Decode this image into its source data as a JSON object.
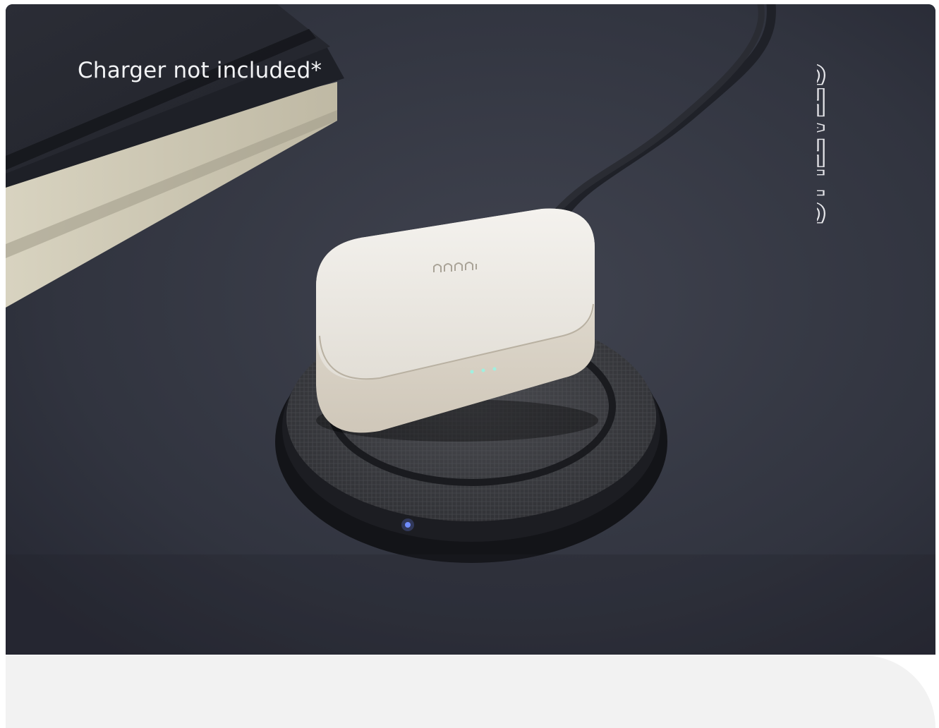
{
  "caption": "Charger not included*",
  "brand_text": "STATUS",
  "colors": {
    "desk": "#30333f",
    "case": "#ece8e0",
    "charger_fabric": "#3b3c40",
    "indicator_light": "#6f8cff",
    "panel": "#f2f2f2"
  }
}
